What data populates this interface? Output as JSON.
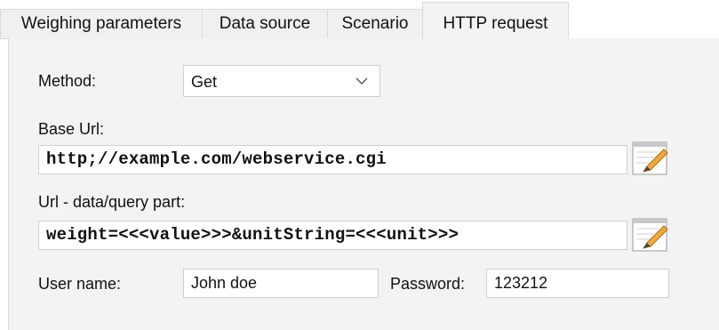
{
  "tabs": [
    {
      "label": "Weighing parameters",
      "active": false
    },
    {
      "label": "Data source",
      "active": false
    },
    {
      "label": "Scenario",
      "active": false
    },
    {
      "label": "HTTP request",
      "active": true
    }
  ],
  "form": {
    "method_label": "Method:",
    "method_value": "Get",
    "base_url_label": "Base Url:",
    "base_url_value": "http;//example.com/webservice.cgi",
    "query_label": "Url - data/query part:",
    "query_value": "weight=<<<value>>>&unitString=<<<unit>>>",
    "username_label": "User name:",
    "username_value": "John doe",
    "password_label": "Password:",
    "password_value": "123212"
  },
  "icons": {
    "method_dropdown": "chevron-down-icon",
    "base_url_edit": "notepad-pencil-icon",
    "query_edit": "notepad-pencil-icon"
  },
  "colors": {
    "panel_bg": "#f3f3f3",
    "tab_bg": "#f0f0f0",
    "border": "#d9d9d9",
    "pencil": "#f2a93b"
  }
}
